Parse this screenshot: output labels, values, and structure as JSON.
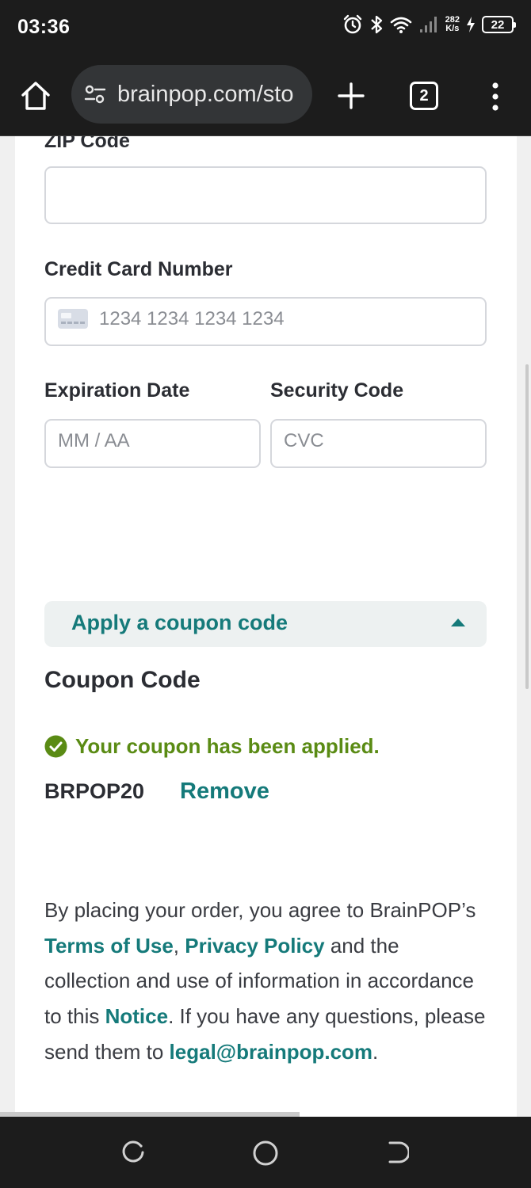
{
  "status_bar": {
    "time": "03:36",
    "net_speed_value": "282",
    "net_speed_unit": "K/s",
    "battery": "22",
    "icons": [
      "alarm-icon",
      "bluetooth-icon",
      "wifi-icon",
      "signal-icon",
      "charging-icon"
    ]
  },
  "browser": {
    "url": "brainpop.com/sto",
    "tab_count": "2",
    "icons": [
      "home-icon",
      "site-settings-icon",
      "new-tab-icon",
      "tab-switcher-icon",
      "more-menu-icon"
    ]
  },
  "form": {
    "zip_label": "ZIP Code",
    "zip_value": "",
    "card_label": "Credit Card Number",
    "card_placeholder": "1234 1234 1234 1234",
    "exp_label": "Expiration Date",
    "exp_placeholder": "MM / AA",
    "cvc_label": "Security Code",
    "cvc_placeholder": "CVC"
  },
  "coupon": {
    "toggle_label": "Apply a coupon code",
    "title": "Coupon Code",
    "applied_message": "Your coupon has been applied.",
    "code": "BRPOP20",
    "remove_label": "Remove"
  },
  "legal": {
    "text_1": "By placing your order, you agree to BrainPOP’s ",
    "terms_link": "Terms of Use",
    "sep": ", ",
    "privacy_link": "Privacy Policy",
    "text_2": " and the collection and use of information in accordance to this ",
    "notice_link": "Notice",
    "text_3": ". If you have any questions, please send them to ",
    "email_link": "legal@brainpop.com",
    "text_4": "."
  },
  "colors": {
    "accent": "#157a7a",
    "success": "#5a8b14",
    "text": "#2b2d33"
  }
}
